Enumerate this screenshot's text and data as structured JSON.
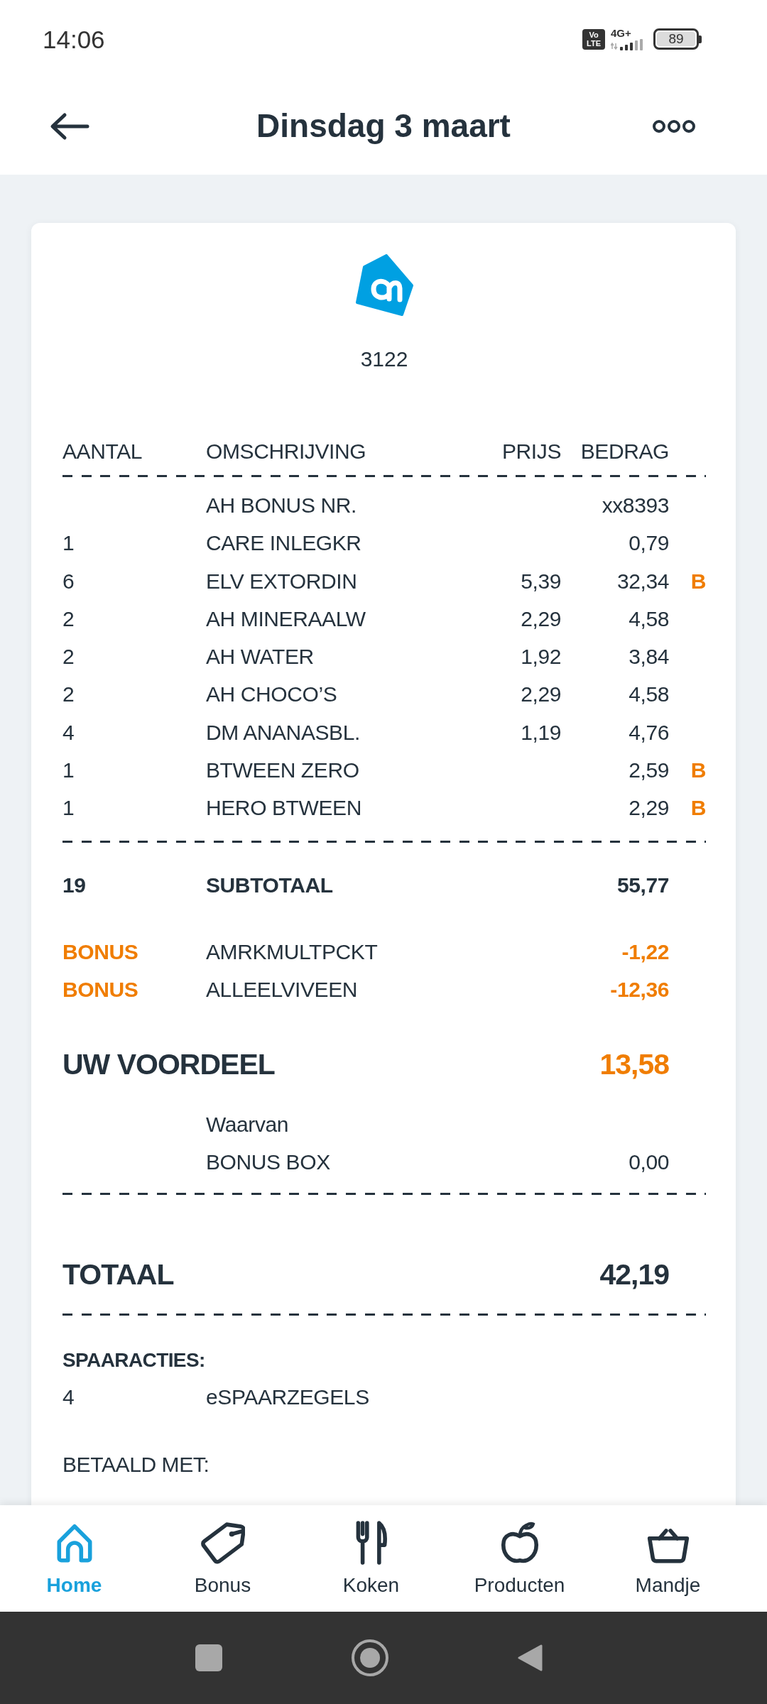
{
  "status_bar": {
    "time": "14:06",
    "volte_badge": "Vo LTE",
    "network": "4G+",
    "battery": "89"
  },
  "header": {
    "title": "Dinsdag 3 maart"
  },
  "receipt": {
    "store_number": "3122",
    "columns": [
      "AANTAL",
      "OMSCHRIJVING",
      "PRIJS",
      "BEDRAG"
    ],
    "items": [
      {
        "description": "AH BONUS NR.",
        "amount": "xx8393"
      },
      {
        "quantity": "1",
        "description": "CARE INLEGKR",
        "amount": "0,79"
      },
      {
        "quantity": "6",
        "description": "ELV EXTORDIN",
        "price": "5,39",
        "amount": "32,34",
        "flag": "B"
      },
      {
        "quantity": "2",
        "description": "AH MINERAALW",
        "price": "2,29",
        "amount": "4,58"
      },
      {
        "quantity": "2",
        "description": "AH WATER",
        "price": "1,92",
        "amount": "3,84"
      },
      {
        "quantity": "2",
        "description": "AH CHOCO’S",
        "price": "2,29",
        "amount": "4,58"
      },
      {
        "quantity": "4",
        "description": "DM ANANASBL.",
        "price": "1,19",
        "amount": "4,76"
      },
      {
        "quantity": "1",
        "description": "BTWEEN ZERO",
        "amount": "2,59",
        "flag": "B"
      },
      {
        "quantity": "1",
        "description": "HERO BTWEEN",
        "amount": "2,29",
        "flag": "B"
      }
    ],
    "subtotal": {
      "quantity": "19",
      "label": "SUBTOTAAL",
      "amount": "55,77"
    },
    "discounts": [
      {
        "label": "BONUS",
        "description": "AMRKMULTPCKT",
        "amount": "-1,22"
      },
      {
        "label": "BONUS",
        "description": "ALLEELVIVEEN",
        "amount": "-12,36"
      }
    ],
    "savings": {
      "label": "UW VOORDEEL",
      "amount": "13,58"
    },
    "breakdown": {
      "label": "Waarvan",
      "description": "BONUS BOX",
      "amount": "0,00"
    },
    "total": {
      "label": "TOTAAL",
      "amount": "42,19"
    },
    "stamps": {
      "heading": "SPAARACTIES:",
      "items": [
        {
          "quantity": "4",
          "description": "eSPAARZEGELS"
        }
      ]
    },
    "payment": {
      "heading": "BETAALD MET:"
    }
  },
  "bottom_nav": [
    {
      "label": "Home",
      "selected": true
    },
    {
      "label": "Bonus",
      "selected": false
    },
    {
      "label": "Koken",
      "selected": false
    },
    {
      "label": "Producten",
      "selected": false
    },
    {
      "label": "Mandje",
      "selected": false
    }
  ]
}
